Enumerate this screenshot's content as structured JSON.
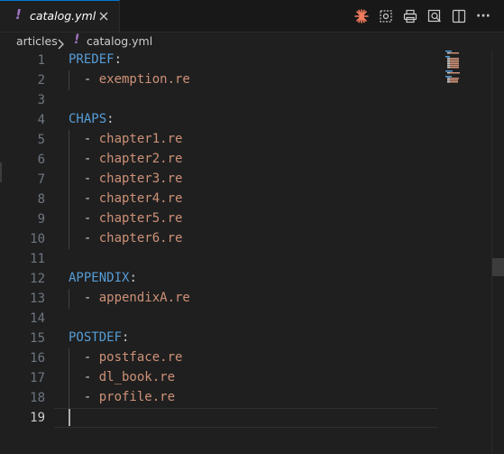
{
  "tab": {
    "icon": "!",
    "filename": "catalog.yml"
  },
  "toolbar": {
    "actions": [
      "copilot-icon",
      "compare-icon",
      "print-icon",
      "open-preview-icon",
      "split-editor-icon",
      "more-actions-icon"
    ],
    "more_label": "···"
  },
  "breadcrumb": {
    "folder": "articles",
    "separator": ">",
    "file_icon": "!",
    "file": "catalog.yml"
  },
  "editor": {
    "language": "yaml",
    "current_line": 19,
    "lines": [
      {
        "n": "1",
        "key": "PREDEF",
        "colon": ":",
        "dash": "",
        "value": ""
      },
      {
        "n": "2",
        "key": "",
        "colon": "",
        "dash": "- ",
        "value": "exemption.re"
      },
      {
        "n": "3",
        "key": "",
        "colon": "",
        "dash": "",
        "value": ""
      },
      {
        "n": "4",
        "key": "CHAPS",
        "colon": ":",
        "dash": "",
        "value": ""
      },
      {
        "n": "5",
        "key": "",
        "colon": "",
        "dash": "- ",
        "value": "chapter1.re"
      },
      {
        "n": "6",
        "key": "",
        "colon": "",
        "dash": "- ",
        "value": "chapter2.re"
      },
      {
        "n": "7",
        "key": "",
        "colon": "",
        "dash": "- ",
        "value": "chapter3.re"
      },
      {
        "n": "8",
        "key": "",
        "colon": "",
        "dash": "- ",
        "value": "chapter4.re"
      },
      {
        "n": "9",
        "key": "",
        "colon": "",
        "dash": "- ",
        "value": "chapter5.re"
      },
      {
        "n": "10",
        "key": "",
        "colon": "",
        "dash": "- ",
        "value": "chapter6.re"
      },
      {
        "n": "11",
        "key": "",
        "colon": "",
        "dash": "",
        "value": ""
      },
      {
        "n": "12",
        "key": "APPENDIX",
        "colon": ":",
        "dash": "",
        "value": ""
      },
      {
        "n": "13",
        "key": "",
        "colon": "",
        "dash": "- ",
        "value": "appendixA.re"
      },
      {
        "n": "14",
        "key": "",
        "colon": "",
        "dash": "",
        "value": ""
      },
      {
        "n": "15",
        "key": "POSTDEF",
        "colon": ":",
        "dash": "",
        "value": ""
      },
      {
        "n": "16",
        "key": "",
        "colon": "",
        "dash": "- ",
        "value": "postface.re"
      },
      {
        "n": "17",
        "key": "",
        "colon": "",
        "dash": "- ",
        "value": "dl_book.re"
      },
      {
        "n": "18",
        "key": "",
        "colon": "",
        "dash": "- ",
        "value": "profile.re"
      },
      {
        "n": "19",
        "key": "",
        "colon": "",
        "dash": "",
        "value": ""
      }
    ]
  },
  "colors": {
    "background": "#1f1f1f",
    "key": "#569cd6",
    "string": "#ce9178",
    "line_number": "#6e7681",
    "active_line_number": "#cccccc",
    "yaml_icon": "#a074c4",
    "copilot": "#f47c5c"
  }
}
